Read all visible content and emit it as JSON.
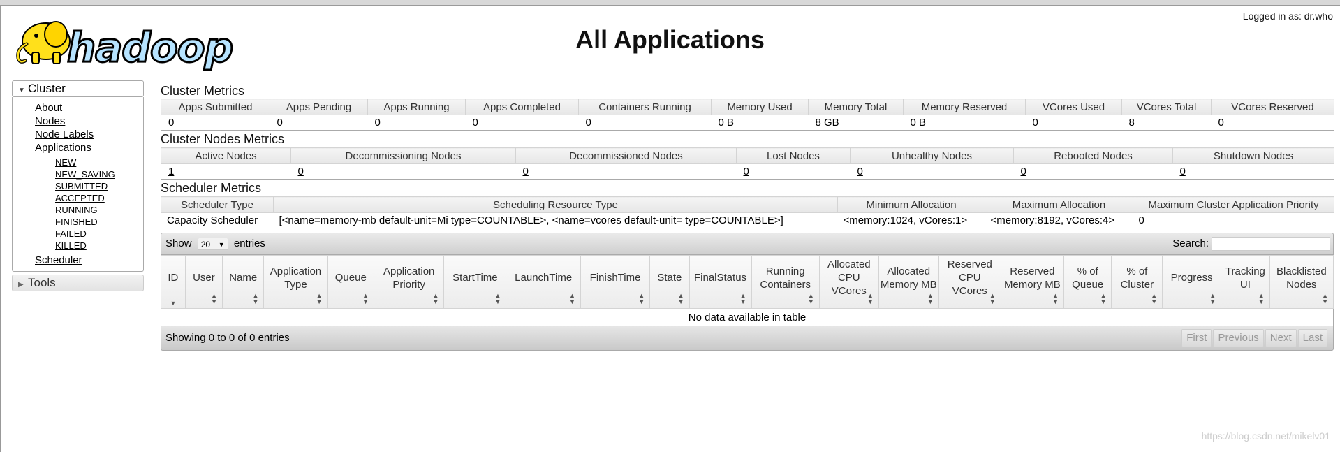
{
  "header": {
    "logo_text": "hadoop",
    "title": "All Applications",
    "login": "Logged in as: dr.who"
  },
  "sidebar": {
    "cluster_label": "Cluster",
    "items": [
      "About",
      "Nodes",
      "Node Labels",
      "Applications"
    ],
    "app_states": [
      "NEW",
      "NEW_SAVING",
      "SUBMITTED",
      "ACCEPTED",
      "RUNNING",
      "FINISHED",
      "FAILED",
      "KILLED"
    ],
    "scheduler": "Scheduler",
    "tools_label": "Tools"
  },
  "cluster_metrics": {
    "title": "Cluster Metrics",
    "headers": [
      "Apps Submitted",
      "Apps Pending",
      "Apps Running",
      "Apps Completed",
      "Containers Running",
      "Memory Used",
      "Memory Total",
      "Memory Reserved",
      "VCores Used",
      "VCores Total",
      "VCores Reserved"
    ],
    "values": [
      "0",
      "0",
      "0",
      "0",
      "0",
      "0 B",
      "8 GB",
      "0 B",
      "0",
      "8",
      "0"
    ]
  },
  "node_metrics": {
    "title": "Cluster Nodes Metrics",
    "headers": [
      "Active Nodes",
      "Decommissioning Nodes",
      "Decommissioned Nodes",
      "Lost Nodes",
      "Unhealthy Nodes",
      "Rebooted Nodes",
      "Shutdown Nodes"
    ],
    "values": [
      "1",
      "0",
      "0",
      "0",
      "0",
      "0",
      "0"
    ]
  },
  "scheduler_metrics": {
    "title": "Scheduler Metrics",
    "headers": [
      "Scheduler Type",
      "Scheduling Resource Type",
      "Minimum Allocation",
      "Maximum Allocation",
      "Maximum Cluster Application Priority"
    ],
    "values": [
      "Capacity Scheduler",
      "[<name=memory-mb default-unit=Mi type=COUNTABLE>, <name=vcores default-unit= type=COUNTABLE>]",
      "<memory:1024, vCores:1>",
      "<memory:8192, vCores:4>",
      "0"
    ]
  },
  "apps_table": {
    "show_label": "Show",
    "page_length": "20",
    "entries_label": "entries",
    "search_label": "Search:",
    "columns": [
      "ID",
      "User",
      "Name",
      "Application Type",
      "Queue",
      "Application Priority",
      "StartTime",
      "LaunchTime",
      "FinishTime",
      "State",
      "FinalStatus",
      "Running Containers",
      "Allocated CPU VCores",
      "Allocated Memory MB",
      "Reserved CPU VCores",
      "Reserved Memory MB",
      "% of Queue",
      "% of Cluster",
      "Progress",
      "Tracking UI",
      "Blacklisted Nodes"
    ],
    "empty_message": "No data available in table",
    "info": "Showing 0 to 0 of 0 entries",
    "pager": [
      "First",
      "Previous",
      "Next",
      "Last"
    ]
  },
  "watermark": "https://blog.csdn.net/mikelv01"
}
